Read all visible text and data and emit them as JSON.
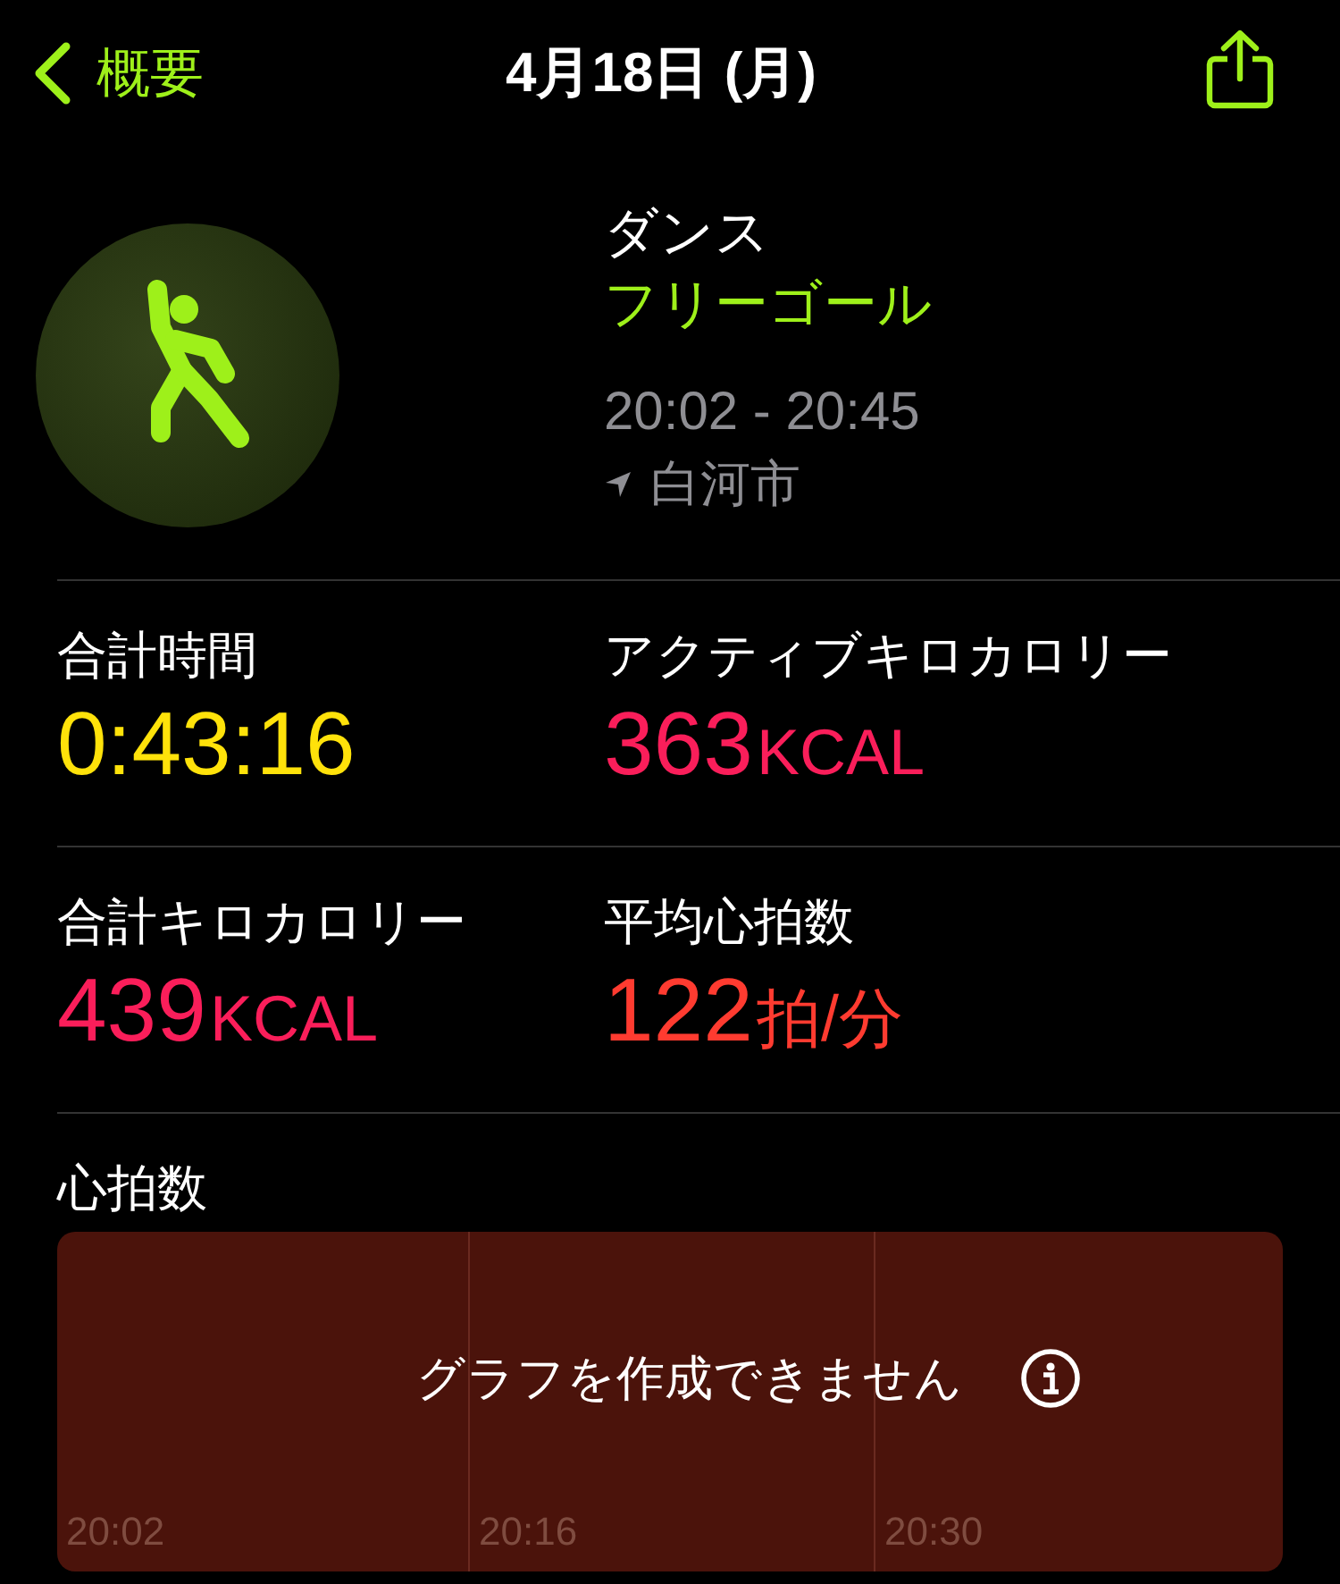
{
  "nav": {
    "back_label": "概要",
    "title": "4月18日 (月)"
  },
  "workout": {
    "type": "ダンス",
    "goal": "フリーゴール",
    "time_range": "20:02 - 20:45",
    "location": "白河市"
  },
  "stats": [
    {
      "label": "合計時間",
      "value": "0:43:16",
      "color": "#ffe20a"
    },
    {
      "label": "アクティブキロカロリー",
      "value": "363",
      "unit": "KCAL",
      "color": "#fa1e5a"
    },
    {
      "label": "合計キロカロリー",
      "value": "439",
      "unit": "KCAL",
      "color": "#fa1e5a"
    },
    {
      "label": "平均心拍数",
      "value": "122",
      "unit": "拍/分",
      "color": "#ff3b30"
    }
  ],
  "heart_rate": {
    "title": "心拍数",
    "message": "グラフを作成できません",
    "x_labels": [
      "20:02",
      "20:16",
      "20:30"
    ]
  }
}
